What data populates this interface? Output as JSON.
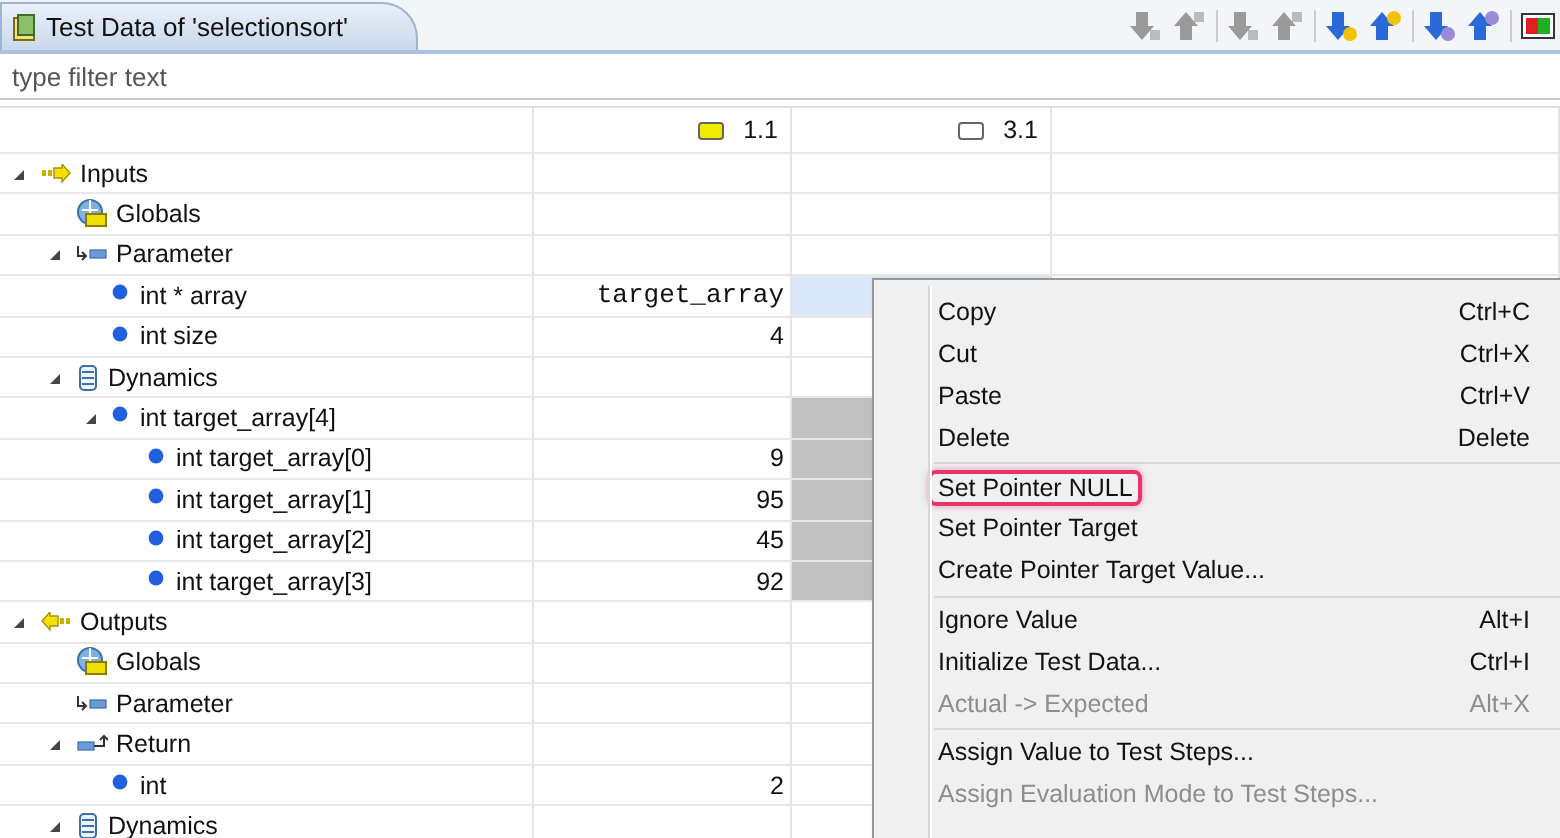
{
  "view": {
    "title": "Test Data of 'selectionsort'"
  },
  "toolbar": [
    {
      "kind": "down",
      "disabled": true
    },
    {
      "kind": "up",
      "disabled": true
    },
    {
      "kind": "down",
      "disabled": true
    },
    {
      "kind": "up",
      "disabled": true
    },
    {
      "kind": "down",
      "disabled": false,
      "color": "#f2c200"
    },
    {
      "kind": "up",
      "disabled": false,
      "color": "#f2c200"
    },
    {
      "kind": "down",
      "disabled": false,
      "color": "#9a8ad8"
    },
    {
      "kind": "up",
      "disabled": false,
      "color": "#9a8ad8"
    },
    {
      "kind": "compare",
      "disabled": false
    }
  ],
  "filter": {
    "placeholder": "type filter text"
  },
  "columns": [
    {
      "label": "1.1",
      "color": "#f0ee00"
    },
    {
      "label": "3.1",
      "color": "#ffffff"
    }
  ],
  "tree": [
    {
      "label": "Inputs",
      "kind": "inputs",
      "expanded": true,
      "selected": false,
      "children": [
        {
          "label": "Globals",
          "kind": "globals",
          "selected": false
        },
        {
          "label": "Parameter",
          "kind": "parameter",
          "expanded": true,
          "selected": false,
          "children": [
            {
              "label": "int * array",
              "kind": "variable",
              "value": "target_array",
              "selected": true
            },
            {
              "label": "int size",
              "kind": "variable",
              "value": "4",
              "selected": false
            }
          ]
        },
        {
          "label": "Dynamics",
          "kind": "dynamics",
          "expanded": true,
          "selected": false,
          "children": [
            {
              "label": "int target_array[4]",
              "kind": "variable",
              "expanded": true,
              "selected": false,
              "shaded": true,
              "children": [
                {
                  "label": "int  target_array[0]",
                  "kind": "variable",
                  "value": "9",
                  "selected": false,
                  "shaded": true
                },
                {
                  "label": "int  target_array[1]",
                  "kind": "variable",
                  "value": "95",
                  "selected": false,
                  "shaded": true
                },
                {
                  "label": "int  target_array[2]",
                  "kind": "variable",
                  "value": "45",
                  "selected": false,
                  "shaded": true
                },
                {
                  "label": "int  target_array[3]",
                  "kind": "variable",
                  "value": "92",
                  "selected": false,
                  "shaded": true
                }
              ]
            }
          ]
        }
      ]
    },
    {
      "label": "Outputs",
      "kind": "outputs",
      "expanded": true,
      "selected": false,
      "children": [
        {
          "label": "Globals",
          "kind": "globals",
          "selected": false
        },
        {
          "label": "Parameter",
          "kind": "parameter",
          "selected": false
        },
        {
          "label": "Return",
          "kind": "return",
          "expanded": true,
          "selected": false,
          "children": [
            {
              "label": "int",
              "kind": "variable",
              "value": "2",
              "selected": false
            }
          ]
        },
        {
          "label": "Dynamics",
          "kind": "dynamics",
          "expanded": true,
          "selected": false
        }
      ]
    }
  ],
  "context_menu": [
    [
      {
        "label": "Copy",
        "shortcut": "Ctrl+C",
        "disabled": false,
        "highlighted": false
      },
      {
        "label": "Cut",
        "shortcut": "Ctrl+X",
        "disabled": false,
        "highlighted": false
      },
      {
        "label": "Paste",
        "shortcut": "Ctrl+V",
        "disabled": false,
        "highlighted": false
      },
      {
        "label": "Delete",
        "shortcut": "Delete",
        "disabled": false,
        "highlighted": false
      }
    ],
    [
      {
        "label": "Set Pointer NULL",
        "disabled": false,
        "highlighted": true
      },
      {
        "label": "Set Pointer Target",
        "disabled": false,
        "highlighted": false
      },
      {
        "label": "Create Pointer Target Value...",
        "disabled": false,
        "highlighted": false
      }
    ],
    [
      {
        "label": "Ignore Value",
        "shortcut": "Alt+I",
        "disabled": false,
        "highlighted": false
      },
      {
        "label": "Initialize Test Data...",
        "shortcut": "Ctrl+I",
        "disabled": false,
        "highlighted": false
      },
      {
        "label": "Actual -> Expected",
        "shortcut": "Alt+X",
        "disabled": true,
        "highlighted": false
      }
    ],
    [
      {
        "label": "Assign Value to Test Steps...",
        "disabled": false,
        "highlighted": false
      },
      {
        "label": "Assign Evaluation Mode to Test Steps...",
        "disabled": true,
        "highlighted": false
      }
    ]
  ]
}
